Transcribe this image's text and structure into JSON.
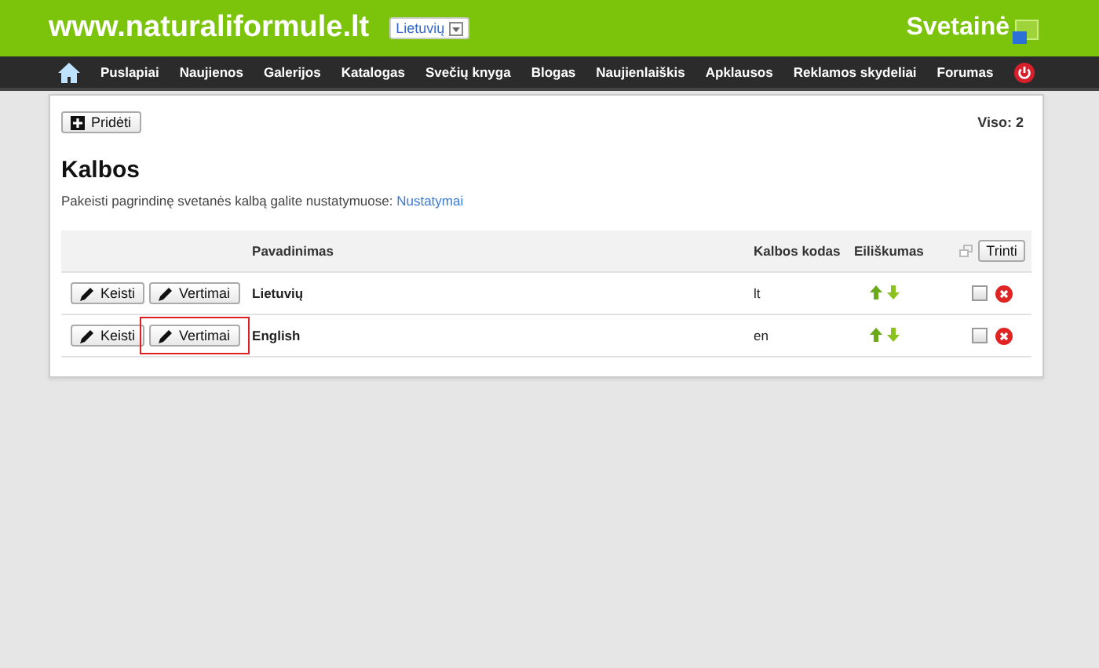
{
  "header": {
    "site": "www.naturaliformule.lt",
    "language": "Lietuvių",
    "logo": "Svetainė"
  },
  "nav": {
    "items": [
      "Puslapiai",
      "Naujienos",
      "Galerijos",
      "Katalogas",
      "Svečių knyga",
      "Blogas",
      "Naujienlaiškis",
      "Apklausos",
      "Reklamos skydeliai",
      "Forumas"
    ]
  },
  "toolbar": {
    "add_button": "Pridėti",
    "total": "Viso: 2"
  },
  "title": "Kalbos",
  "note": {
    "text": "Pakeisti pagrindinę svetanės kalbą galite nustatymuose:",
    "link": "Nustatymai"
  },
  "table": {
    "columns": [
      "Pavadinimas",
      "Kalbos kodas",
      "Eiliškumas"
    ],
    "delete_button": "Trinti",
    "rows": [
      {
        "edit": "Keisti",
        "translations": "Vertimai",
        "highlighted": false,
        "name": "Lietuvių",
        "code": "lt",
        "checked": false
      },
      {
        "edit": "Keisti",
        "translations": "Vertimai",
        "highlighted": true,
        "name": "English",
        "code": "en",
        "checked": false
      }
    ]
  }
}
